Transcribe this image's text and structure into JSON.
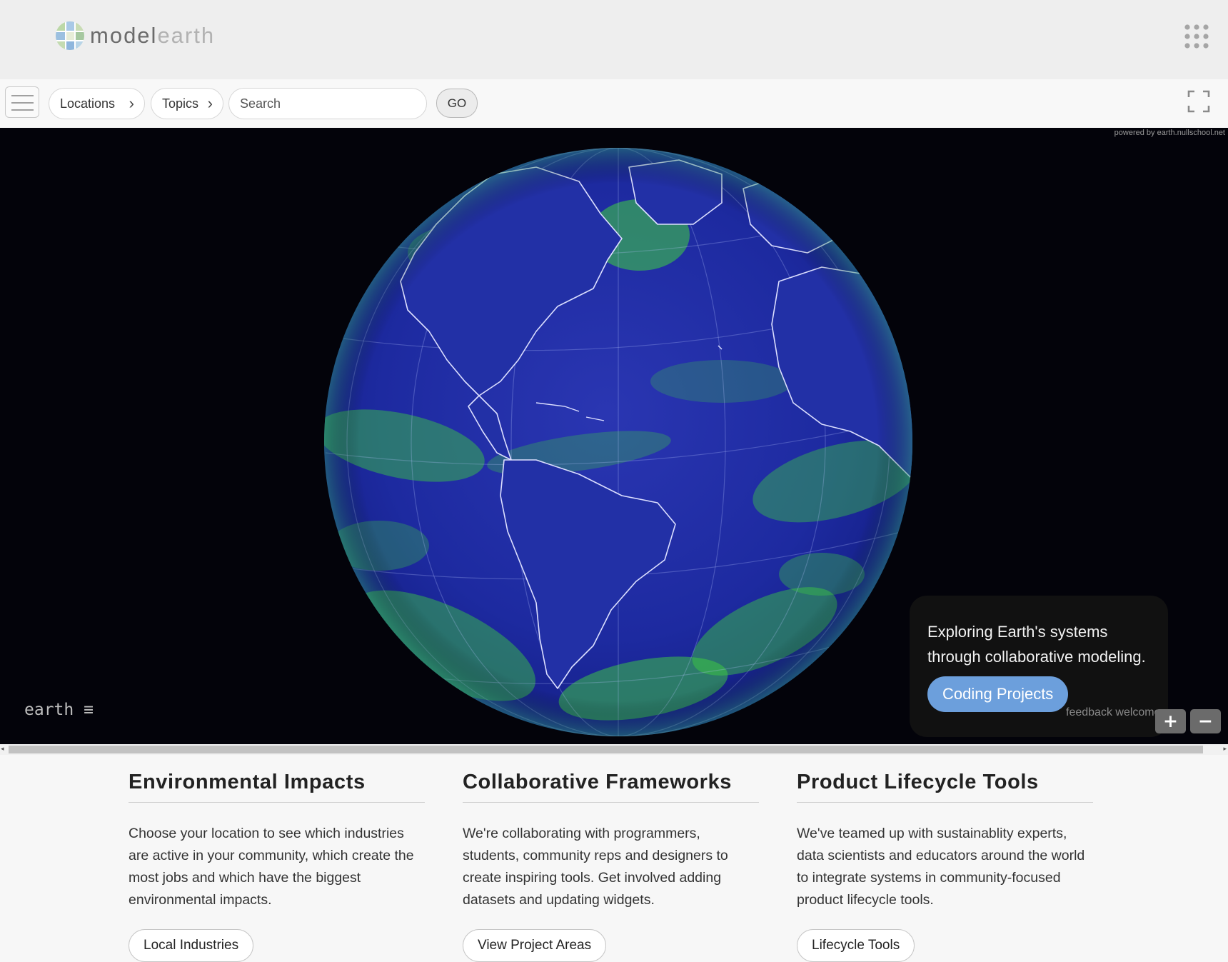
{
  "header": {
    "logo_part1": "model",
    "logo_part2": "earth",
    "apps_icon": "apps-grid-icon"
  },
  "navbar": {
    "menu_icon": "hamburger-icon",
    "locations_label": "Locations",
    "topics_label": "Topics",
    "search_placeholder": "Search",
    "go_label": "GO",
    "fullscreen_icon": "fullscreen-icon"
  },
  "viewer": {
    "powered_by": "powered by earth.nullschool.net",
    "earth_label": "earth ≡",
    "info_text": "Exploring Earth's systems through collaborative modeling.",
    "coding_button": "Coding Projects",
    "feedback": "feedback welcome",
    "zoom_in": "+",
    "zoom_out": "−"
  },
  "colors": {
    "accent_button": "#6c9fdc",
    "globe_ocean": "#1d2fa8",
    "wind_green": "#3fd13f"
  },
  "columns": [
    {
      "title": "Environmental Impacts",
      "text": "Choose your location to see which industries are active in your community, which create the most jobs and which have the biggest environmental impacts.",
      "button": "Local Industries"
    },
    {
      "title": "Collaborative Frameworks",
      "text": "We're collaborating with programmers, students, community reps and designers to create inspiring tools. Get involved adding datasets and updating widgets.",
      "button": "View Project Areas"
    },
    {
      "title": "Product Lifecycle Tools",
      "text": "We've teamed up with sustainablity experts, data scientists and educators around the world to integrate systems in community-focused product lifecycle tools.",
      "button": "Lifecycle Tools"
    }
  ]
}
